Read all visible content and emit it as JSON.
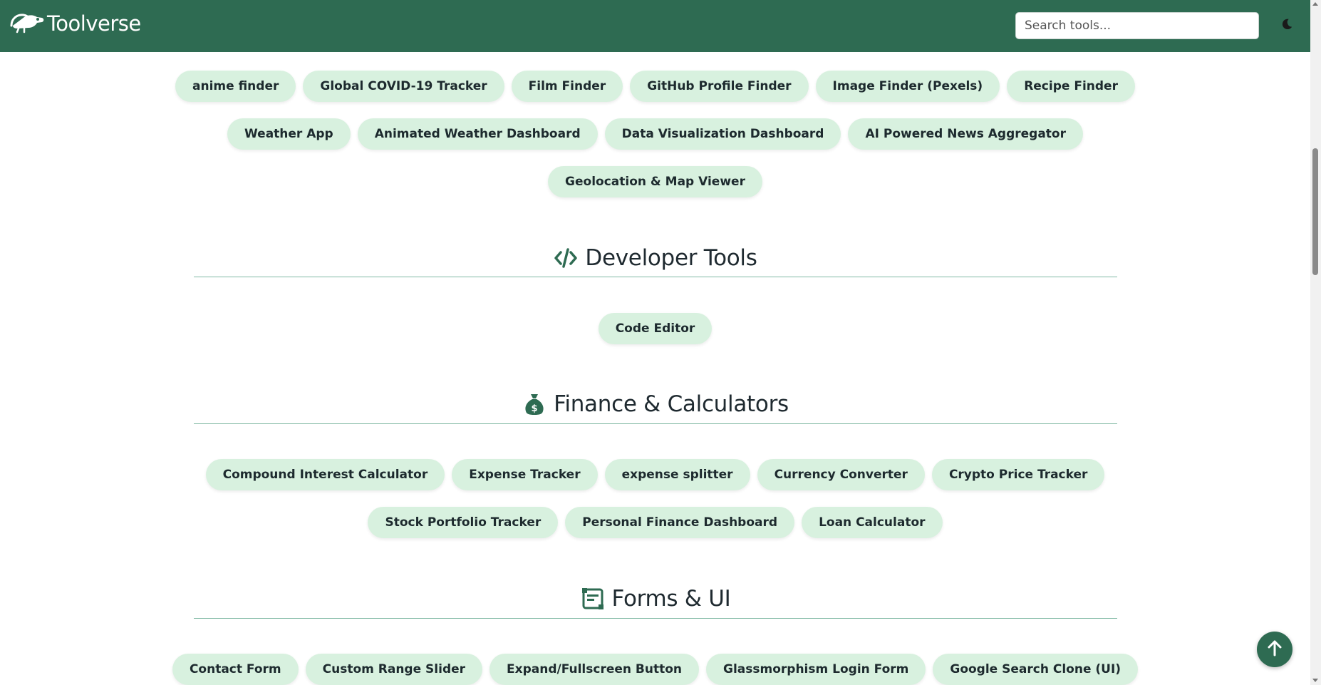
{
  "brand": {
    "name": "Toolverse",
    "logo_icon": "chameleon-logo"
  },
  "search": {
    "placeholder": "Search tools..."
  },
  "theme_toggle": {
    "icon": "moon-icon"
  },
  "colors": {
    "header": "#2e6b52",
    "chip": "#d8f1df",
    "accent": "#2e6b52"
  },
  "api_tools": {
    "row1": [
      "anime finder",
      "Global COVID-19 Tracker",
      "Film Finder",
      "GitHub Profile Finder",
      "Image Finder (Pexels)",
      "Recipe Finder"
    ],
    "row2": [
      "Weather App",
      "Animated Weather Dashboard",
      "Data Visualization Dashboard",
      "AI Powered News Aggregator"
    ],
    "row3": [
      "Geolocation & Map Viewer"
    ]
  },
  "developer_tools": {
    "title": "Developer Tools",
    "icon": "code-icon",
    "row1": [
      "Code Editor"
    ]
  },
  "finance": {
    "title": "Finance & Calculators",
    "icon": "money-bag-icon",
    "row1": [
      "Compound Interest Calculator",
      "Expense Tracker",
      "expense splitter",
      "Currency Converter",
      "Crypto Price Tracker"
    ],
    "row2": [
      "Stock Portfolio Tracker",
      "Personal Finance Dashboard",
      "Loan Calculator"
    ]
  },
  "forms_ui": {
    "title": "Forms & UI",
    "icon": "form-icon",
    "row1": [
      "Contact Form",
      "Custom Range Slider",
      "Expand/Fullscreen Button",
      "Glassmorphism Login Form",
      "Google Search Clone (UI)"
    ]
  },
  "back_to_top": {
    "icon": "arrow-up-icon"
  }
}
